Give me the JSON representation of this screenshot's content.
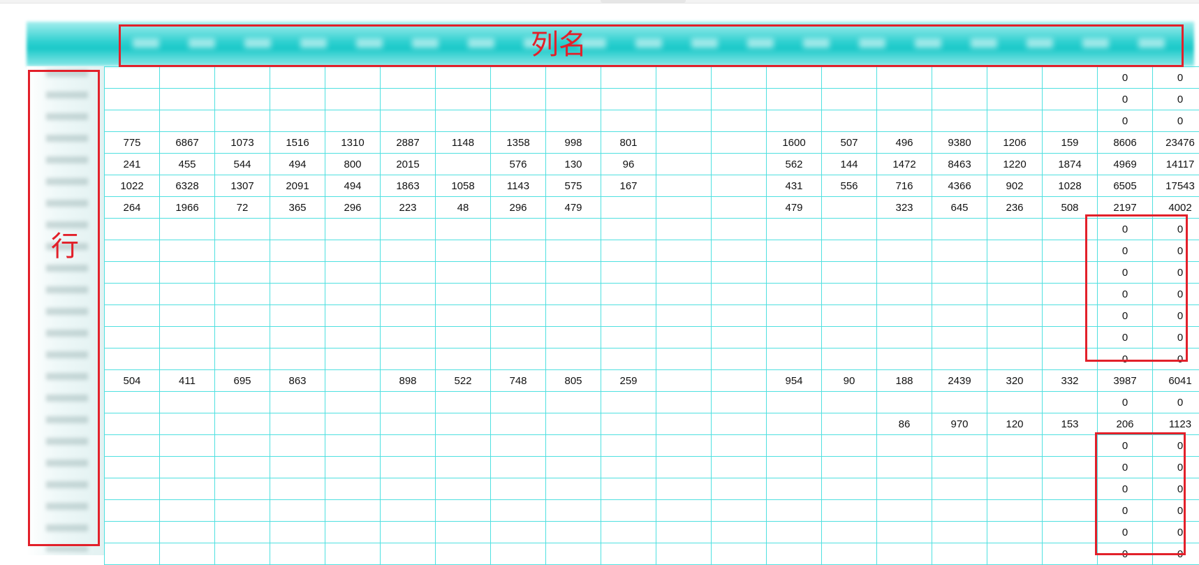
{
  "annotations": {
    "column_label": "列名",
    "row_label": "行"
  },
  "colors": {
    "header_band": "#1bc9c9",
    "gridline": "#4fe0e0",
    "annotation": "#e2202a",
    "cell_text": "#111111"
  },
  "table": {
    "column_count": 20,
    "rows": [
      [
        "",
        "",
        "",
        "",
        "",
        "",
        "",
        "",
        "",
        "",
        "",
        "",
        "",
        "",
        "",
        "",
        "",
        "",
        "0",
        "0"
      ],
      [
        "",
        "",
        "",
        "",
        "",
        "",
        "",
        "",
        "",
        "",
        "",
        "",
        "",
        "",
        "",
        "",
        "",
        "",
        "0",
        "0"
      ],
      [
        "",
        "",
        "",
        "",
        "",
        "",
        "",
        "",
        "",
        "",
        "",
        "",
        "",
        "",
        "",
        "",
        "",
        "",
        "0",
        "0"
      ],
      [
        "775",
        "6867",
        "1073",
        "1516",
        "1310",
        "2887",
        "1148",
        "1358",
        "998",
        "801",
        "",
        "",
        "1600",
        "507",
        "496",
        "9380",
        "1206",
        "159",
        "8606",
        "23476"
      ],
      [
        "241",
        "455",
        "544",
        "494",
        "800",
        "2015",
        "",
        "576",
        "130",
        "96",
        "",
        "",
        "562",
        "144",
        "1472",
        "8463",
        "1220",
        "1874",
        "4969",
        "14117"
      ],
      [
        "1022",
        "6328",
        "1307",
        "2091",
        "494",
        "1863",
        "1058",
        "1143",
        "575",
        "167",
        "",
        "",
        "431",
        "556",
        "716",
        "4366",
        "902",
        "1028",
        "6505",
        "17543"
      ],
      [
        "264",
        "1966",
        "72",
        "365",
        "296",
        "223",
        "48",
        "296",
        "479",
        "",
        "",
        "",
        "479",
        "",
        "323",
        "645",
        "236",
        "508",
        "2197",
        "4002"
      ],
      [
        "",
        "",
        "",
        "",
        "",
        "",
        "",
        "",
        "",
        "",
        "",
        "",
        "",
        "",
        "",
        "",
        "",
        "",
        "0",
        "0"
      ],
      [
        "",
        "",
        "",
        "",
        "",
        "",
        "",
        "",
        "",
        "",
        "",
        "",
        "",
        "",
        "",
        "",
        "",
        "",
        "0",
        "0"
      ],
      [
        "",
        "",
        "",
        "",
        "",
        "",
        "",
        "",
        "",
        "",
        "",
        "",
        "",
        "",
        "",
        "",
        "",
        "",
        "0",
        "0"
      ],
      [
        "",
        "",
        "",
        "",
        "",
        "",
        "",
        "",
        "",
        "",
        "",
        "",
        "",
        "",
        "",
        "",
        "",
        "",
        "0",
        "0"
      ],
      [
        "",
        "",
        "",
        "",
        "",
        "",
        "",
        "",
        "",
        "",
        "",
        "",
        "",
        "",
        "",
        "",
        "",
        "",
        "0",
        "0"
      ],
      [
        "",
        "",
        "",
        "",
        "",
        "",
        "",
        "",
        "",
        "",
        "",
        "",
        "",
        "",
        "",
        "",
        "",
        "",
        "0",
        "0"
      ],
      [
        "",
        "",
        "",
        "",
        "",
        "",
        "",
        "",
        "",
        "",
        "",
        "",
        "",
        "",
        "",
        "",
        "",
        "",
        "0",
        "0"
      ],
      [
        "504",
        "411",
        "695",
        "863",
        "",
        "898",
        "522",
        "748",
        "805",
        "259",
        "",
        "",
        "954",
        "90",
        "188",
        "2439",
        "320",
        "332",
        "3987",
        "6041"
      ],
      [
        "",
        "",
        "",
        "",
        "",
        "",
        "",
        "",
        "",
        "",
        "",
        "",
        "",
        "",
        "",
        "",
        "",
        "",
        "0",
        "0"
      ],
      [
        "",
        "",
        "",
        "",
        "",
        "",
        "",
        "",
        "",
        "",
        "",
        "",
        "",
        "",
        "86",
        "970",
        "120",
        "153",
        "206",
        "1123"
      ],
      [
        "",
        "",
        "",
        "",
        "",
        "",
        "",
        "",
        "",
        "",
        "",
        "",
        "",
        "",
        "",
        "",
        "",
        "",
        "0",
        "0"
      ],
      [
        "",
        "",
        "",
        "",
        "",
        "",
        "",
        "",
        "",
        "",
        "",
        "",
        "",
        "",
        "",
        "",
        "",
        "",
        "0",
        "0"
      ],
      [
        "",
        "",
        "",
        "",
        "",
        "",
        "",
        "",
        "",
        "",
        "",
        "",
        "",
        "",
        "",
        "",
        "",
        "",
        "0",
        "0"
      ],
      [
        "",
        "",
        "",
        "",
        "",
        "",
        "",
        "",
        "",
        "",
        "",
        "",
        "",
        "",
        "",
        "",
        "",
        "",
        "0",
        "0"
      ],
      [
        "",
        "",
        "",
        "",
        "",
        "",
        "",
        "",
        "",
        "",
        "",
        "",
        "",
        "",
        "",
        "",
        "",
        "",
        "0",
        "0"
      ],
      [
        "",
        "",
        "",
        "",
        "",
        "",
        "",
        "",
        "",
        "",
        "",
        "",
        "",
        "",
        "",
        "",
        "",
        "",
        "0",
        "0"
      ]
    ]
  }
}
